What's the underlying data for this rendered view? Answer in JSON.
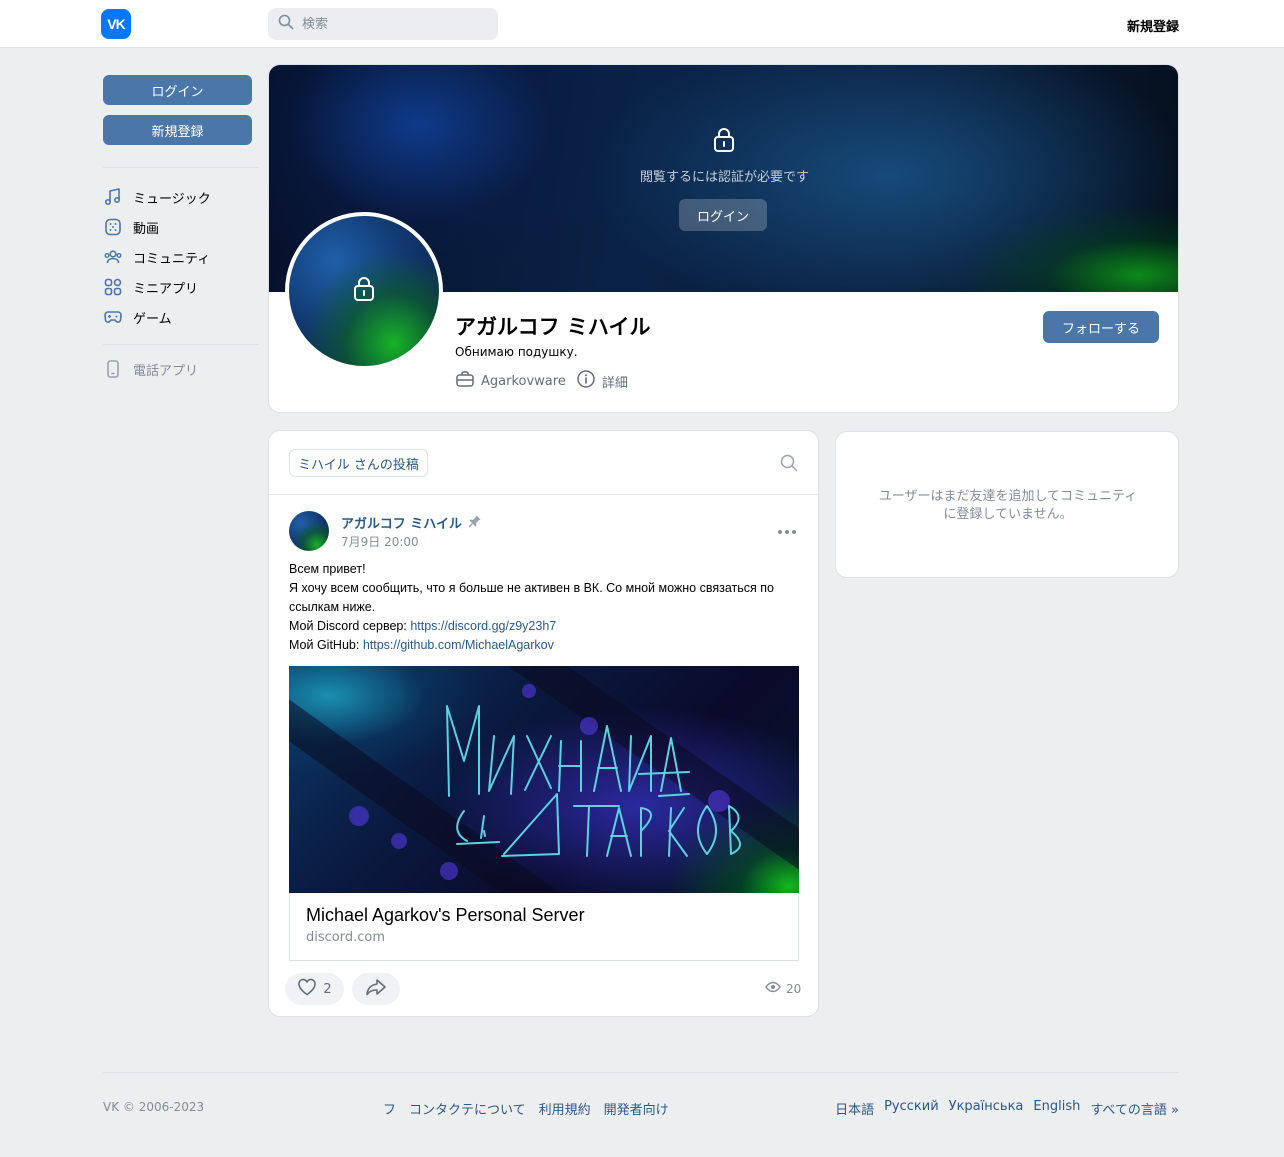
{
  "header": {
    "logo_text": "VK",
    "search_placeholder": "検索",
    "register_label": "新規登録"
  },
  "sidebar": {
    "login_label": "ログイン",
    "register_label": "新規登録",
    "items": [
      {
        "label": "ミュージック",
        "icon": "music-icon"
      },
      {
        "label": "動画",
        "icon": "video-icon"
      },
      {
        "label": "コミュニティ",
        "icon": "users-icon"
      },
      {
        "label": "ミニアプリ",
        "icon": "apps-icon"
      },
      {
        "label": "ゲーム",
        "icon": "gamepad-icon"
      }
    ],
    "phone_app_label": "電話アプリ"
  },
  "profile": {
    "auth_required_text": "閲覧するには認証が必要です",
    "cover_login_label": "ログイン",
    "name": "アガルコフ ミハイル",
    "status": "Обнимаю подушку.",
    "work": "Agarkovware",
    "details_label": "詳細",
    "follow_label": "フォローする"
  },
  "posts": {
    "tab_label": "ミハイル さんの投稿",
    "post": {
      "author": "アガルコフ ミハイル",
      "date": "7月9日 20:00",
      "line1": "Всем привет!",
      "line2": "Я хочу всем сообщить, что я больше не активен в ВК. Со мной можно связаться по ссылкам ниже.",
      "discord_prefix": "Мой Discord сервер: ",
      "discord_link": "https://discord.gg/z9y23h7",
      "github_prefix": "Мой GitHub: ",
      "github_link": "https://github.com/MichaelAgarkov",
      "image_text_line1": "Михаил",
      "image_text_line2": "Агарков",
      "link_title": "Michael Agarkov's Personal Server",
      "link_domain": "discord.com",
      "likes": "2",
      "views": "20"
    }
  },
  "friends": {
    "empty_text": "ユーザーはまだ友達を追加してコミュニティに登録していません。"
  },
  "footer": {
    "copyright": "VK © 2006-2023",
    "links": [
      "フ",
      "コンタクテについて",
      "利用規約",
      "開発者向け"
    ],
    "languages": [
      "日本語",
      "Русский",
      "Українська",
      "English",
      "すべての言語 »"
    ]
  },
  "colors": {
    "accent": "#4a76a8",
    "link": "#2a5885",
    "brand": "#0077ff",
    "background": "#edeef0"
  }
}
